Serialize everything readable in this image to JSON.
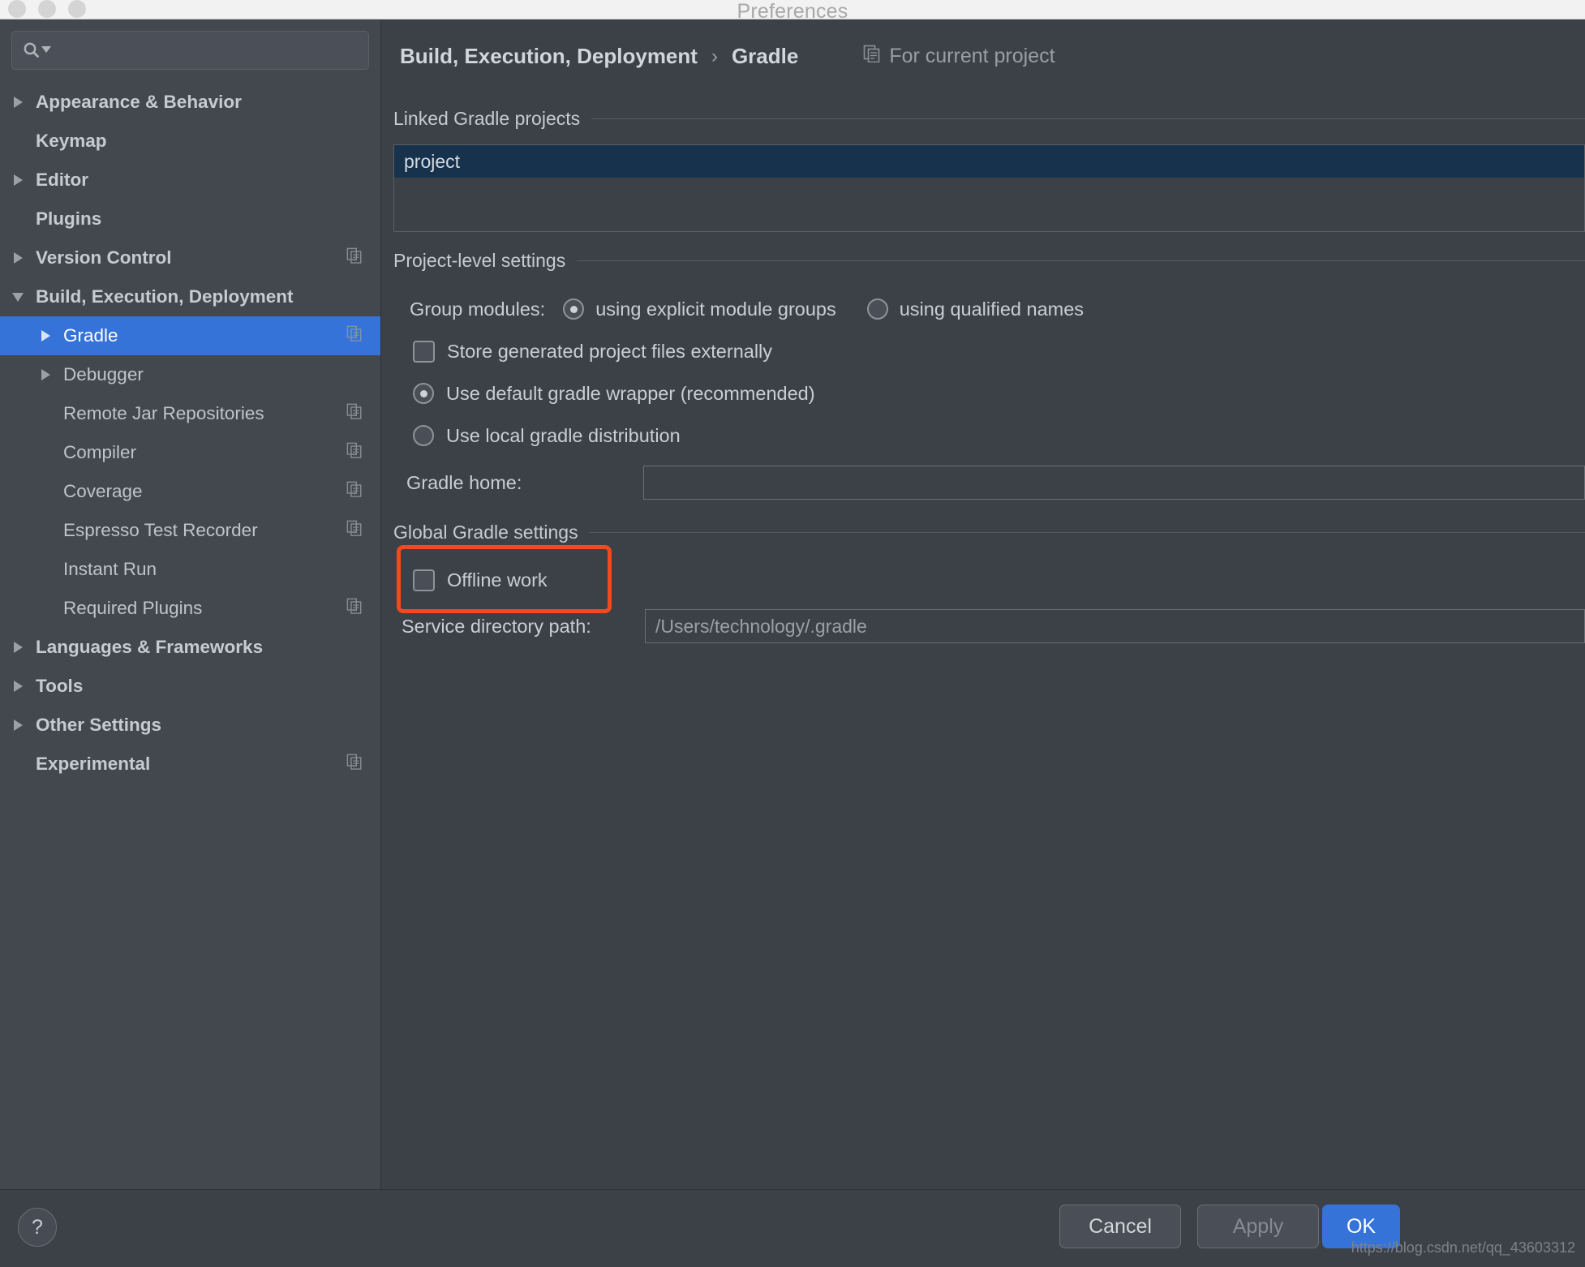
{
  "window": {
    "title": "Preferences",
    "traffic_lights": [
      "close",
      "minimize",
      "zoom"
    ]
  },
  "sidebar": {
    "search": {
      "value": "",
      "placeholder": ""
    },
    "items": [
      {
        "label": "Appearance & Behavior",
        "indent": 0,
        "arrow": "right",
        "bold": true,
        "copy": false,
        "selected": false
      },
      {
        "label": "Keymap",
        "indent": 0,
        "arrow": "none",
        "bold": true,
        "copy": false,
        "selected": false
      },
      {
        "label": "Editor",
        "indent": 0,
        "arrow": "right",
        "bold": true,
        "copy": false,
        "selected": false
      },
      {
        "label": "Plugins",
        "indent": 0,
        "arrow": "none",
        "bold": true,
        "copy": false,
        "selected": false
      },
      {
        "label": "Version Control",
        "indent": 0,
        "arrow": "right",
        "bold": true,
        "copy": true,
        "selected": false
      },
      {
        "label": "Build, Execution, Deployment",
        "indent": 0,
        "arrow": "down",
        "bold": true,
        "copy": false,
        "selected": false
      },
      {
        "label": "Gradle",
        "indent": 1,
        "arrow": "right",
        "bold": false,
        "copy": true,
        "selected": true
      },
      {
        "label": "Debugger",
        "indent": 1,
        "arrow": "right",
        "bold": false,
        "copy": false,
        "selected": false
      },
      {
        "label": "Remote Jar Repositories",
        "indent": 1,
        "arrow": "none",
        "bold": false,
        "copy": true,
        "selected": false
      },
      {
        "label": "Compiler",
        "indent": 1,
        "arrow": "none",
        "bold": false,
        "copy": true,
        "selected": false
      },
      {
        "label": "Coverage",
        "indent": 1,
        "arrow": "none",
        "bold": false,
        "copy": true,
        "selected": false
      },
      {
        "label": "Espresso Test Recorder",
        "indent": 1,
        "arrow": "none",
        "bold": false,
        "copy": true,
        "selected": false
      },
      {
        "label": "Instant Run",
        "indent": 1,
        "arrow": "none",
        "bold": false,
        "copy": false,
        "selected": false
      },
      {
        "label": "Required Plugins",
        "indent": 1,
        "arrow": "none",
        "bold": false,
        "copy": true,
        "selected": false
      },
      {
        "label": "Languages & Frameworks",
        "indent": 0,
        "arrow": "right",
        "bold": true,
        "copy": false,
        "selected": false
      },
      {
        "label": "Tools",
        "indent": 0,
        "arrow": "right",
        "bold": true,
        "copy": false,
        "selected": false
      },
      {
        "label": "Other Settings",
        "indent": 0,
        "arrow": "right",
        "bold": true,
        "copy": false,
        "selected": false
      },
      {
        "label": "Experimental",
        "indent": 0,
        "arrow": "none",
        "bold": true,
        "copy": true,
        "selected": false
      }
    ]
  },
  "breadcrumb": {
    "root": "Build, Execution, Deployment",
    "separator": "›",
    "leaf": "Gradle",
    "scope_label": "For current project"
  },
  "linked_projects": {
    "section_title": "Linked Gradle projects",
    "rows": [
      {
        "name": "project",
        "selected": true
      }
    ]
  },
  "project_settings": {
    "section_title": "Project-level settings",
    "group_modules": {
      "label": "Group modules:",
      "options": [
        {
          "label": "using explicit module groups",
          "selected": true
        },
        {
          "label": "using qualified names",
          "selected": false,
          "mnemonic": "q"
        }
      ]
    },
    "store_externally": {
      "label": "Store generated project files externally",
      "checked": false
    },
    "distribution": [
      {
        "label": "Use default gradle wrapper (recommended)",
        "selected": true
      },
      {
        "label": "Use local gradle distribution",
        "selected": false
      }
    ],
    "gradle_home": {
      "label": "Gradle home:",
      "value": "",
      "placeholder": ""
    }
  },
  "global_settings": {
    "section_title": "Global Gradle settings",
    "offline_work": {
      "label": "Offline work",
      "checked": false,
      "highlight_color": "#f4491c"
    },
    "service_directory": {
      "label": "Service directory path:",
      "value": "/Users/technology/.gradle"
    }
  },
  "footer": {
    "help_label": "?",
    "cancel_label": "Cancel",
    "apply_label": "Apply",
    "ok_label": "OK"
  },
  "watermark": "https://blog.csdn.net/qq_43603312"
}
